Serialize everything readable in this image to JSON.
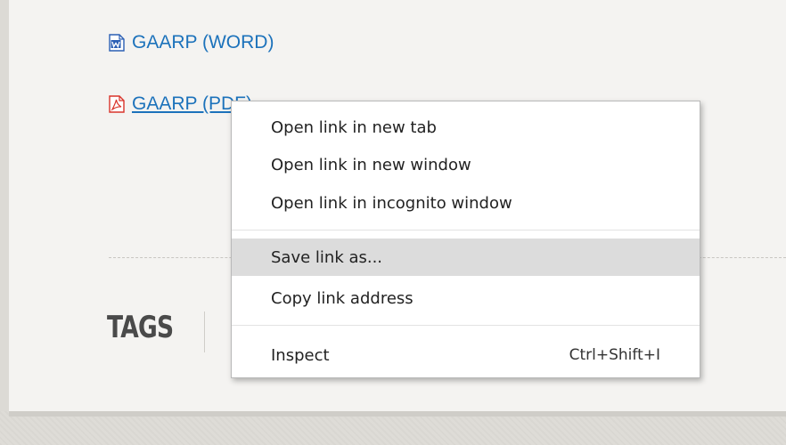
{
  "links": [
    {
      "label": "GAARP (WORD)",
      "icon": "word-document-icon"
    },
    {
      "label": "GAARP (PDF)",
      "icon": "pdf-document-icon"
    }
  ],
  "tags_heading": "TAGS",
  "context_menu": {
    "items": [
      {
        "label": "Open link in new tab"
      },
      {
        "label": "Open link in new window"
      },
      {
        "label": "Open link in incognito window"
      },
      {
        "label": "Save link as..."
      },
      {
        "label": "Copy link address"
      },
      {
        "label": "Inspect",
        "shortcut": "Ctrl+Shift+I"
      }
    ],
    "highlighted": "Save link as..."
  },
  "colors": {
    "link": "#1c72bb",
    "word_icon": "#2b5fb4",
    "pdf_icon": "#d9342b",
    "menu_hover": "#dcdcdc"
  }
}
